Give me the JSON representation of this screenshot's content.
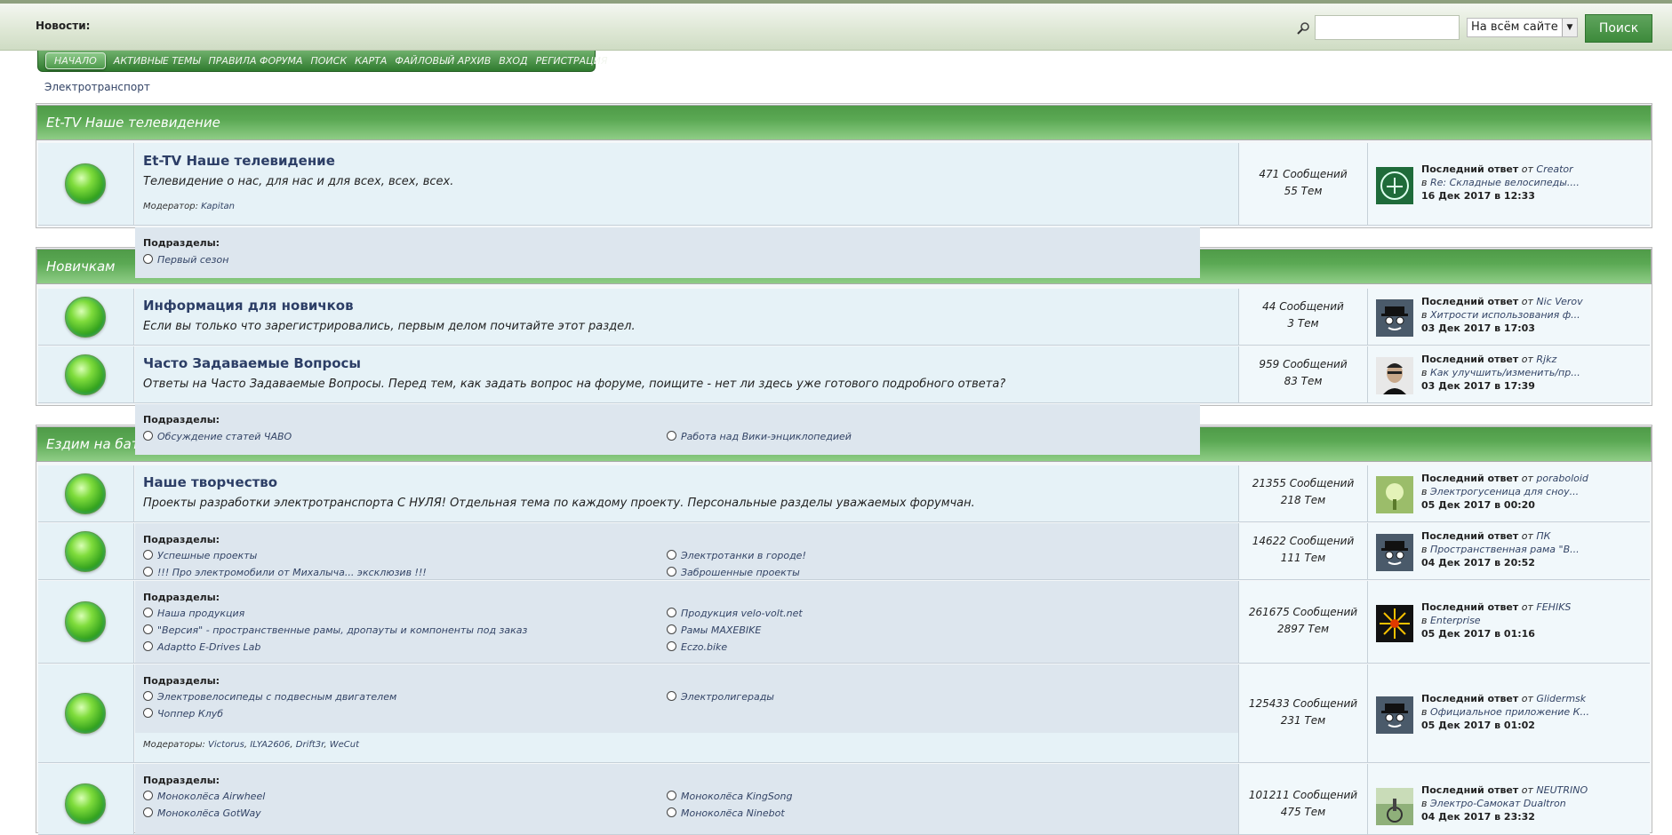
{
  "topbar": {
    "news_label": "Новости:",
    "search_placeholder": "",
    "search_scope": "На всём сайте",
    "search_button": "Поиск"
  },
  "nav": {
    "items": [
      "НАЧАЛО",
      "АКТИВНЫЕ ТЕМЫ",
      "ПРАВИЛА ФОРУМА",
      "ПОИСК",
      "КАРТА",
      "ФАЙЛОВЫЙ АРХИВ",
      "ВХОД",
      "РЕГИСТРАЦИЯ"
    ]
  },
  "breadcrumb": "Электротранспорт",
  "categories": [
    {
      "title": "Et-TV Наше телевидение"
    },
    {
      "title": "Новичкам"
    },
    {
      "title": "Ездим на бат"
    }
  ],
  "labels": {
    "subforums": "Подразделы:",
    "moderator": "Модератор:",
    "moderators": "Модераторы:",
    "last_reply": "Последний ответ",
    "from": "от",
    "in": "в"
  },
  "forums": [
    {
      "title": "Et-TV Наше телевидение",
      "desc": "Телевидение о нас, для нас и для всех, всех, всех.",
      "moderator": "Kapitan",
      "posts": "471 Сообщений",
      "topics": "55 Тем",
      "last_author": "Creator",
      "last_topic": "Re: Складные велосипеды....",
      "last_date": "16 Дек 2017 в 12:33",
      "subforums": [
        "Первый сезон"
      ]
    },
    {
      "title": "Информация для новичков",
      "desc": "Если вы только что зарегистрировались, первым делом почитайте этот раздел.",
      "posts": "44 Сообщений",
      "topics": "3 Тем",
      "last_author": "Nic Verov",
      "last_topic": "Хитрости использования ф...",
      "last_date": "03 Дек 2017 в 17:03"
    },
    {
      "title": "Часто Задаваемые Вопросы",
      "desc": "Ответы на Часто Задаваемые Вопросы. Перед тем, как задать вопрос на форуме, поищите - нет ли здесь уже готового подробного ответа?",
      "posts": "959 Сообщений",
      "topics": "83 Тем",
      "last_author": "Rjkz",
      "last_topic": "Как улучшить/изменить/пр...",
      "last_date": "03 Дек 2017 в 17:39",
      "subforums": [
        "Обсуждение статей ЧАВО",
        "Работа над Вики-энциклопедией"
      ]
    },
    {
      "title": "Наше творчество",
      "desc": "Проекты разработки электротранспорта С НУЛЯ! Отдельная тема по каждому проекту. Персональные разделы уважаемых форумчан.",
      "posts": "21355 Сообщений",
      "topics": "218 Тем",
      "last_author": "poraboloid",
      "last_topic": "Электрогусеница для сноу...",
      "last_date": "05 Дек 2017 в 00:20"
    },
    {
      "posts": "14622 Сообщений",
      "topics": "111 Тем",
      "last_author": "ПК",
      "last_topic": "Пространственная рама \"В...",
      "last_date": "04 Дек 2017 в 20:52",
      "subforums": [
        "Успешные проекты",
        "Электротанки в городе!",
        "!!! Про электромобили от Михалыча... эксклюзив !!!",
        "Заброшенные проекты"
      ]
    },
    {
      "posts": "261675 Сообщений",
      "topics": "2897 Тем",
      "last_author": "FEHIKS",
      "last_topic": "Enterprise",
      "last_date": "05 Дек 2017 в 01:16",
      "subforums": [
        "Наша продукция",
        "Продукция velo-volt.net",
        "\"Версия\" - пространственные рамы, дропауты и компоненты под заказ",
        "Рамы MAXEBIKE",
        "Adaptto E-Drives Lab",
        "Eczo.bike"
      ]
    },
    {
      "posts": "125433 Сообщений",
      "topics": "231 Тем",
      "last_author": "Glidermsk",
      "last_topic": "Официальное приложение К...",
      "last_date": "05 Дек 2017 в 01:02",
      "subforums": [
        "Электровелосипеды с подвесным двигателем",
        "Электролигерады",
        "Чоппер Клуб"
      ],
      "moderators": [
        "Victorus",
        "ILYA2606",
        "Drift3r",
        "WeCut"
      ]
    },
    {
      "posts": "101211 Сообщений",
      "topics": "475 Тем",
      "last_author": "NEUTRINO",
      "last_topic": "Электро-Самокат Dualtron",
      "last_date": "04 Дек 2017 в 23:32",
      "subforums": [
        "Моноколёса Airwheel",
        "Моноколёса KingSong",
        "Моноколёса GotWay",
        "Моноколёса Ninebot"
      ]
    }
  ],
  "colors": {
    "header_green": "#5aa853",
    "nav_green": "#2f7a2e",
    "row_bg": "#e6f2f7",
    "link": "#334466"
  }
}
